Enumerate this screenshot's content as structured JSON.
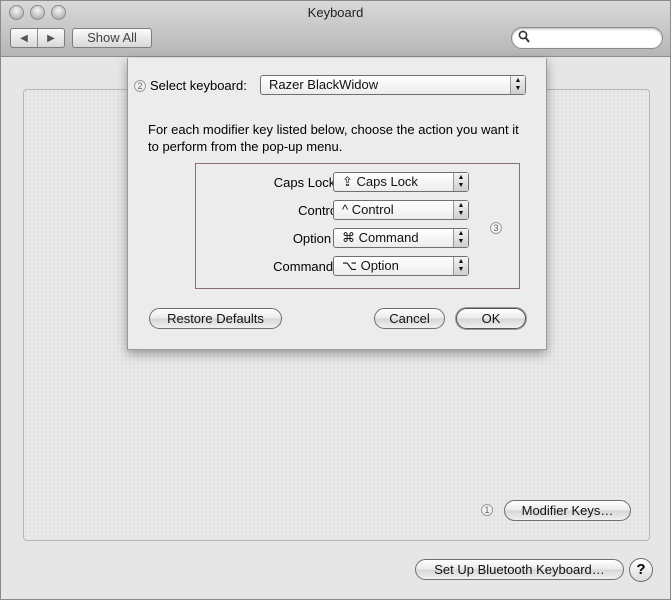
{
  "window": {
    "title": "Keyboard",
    "back_glyph": "◀",
    "forward_glyph": "▶",
    "show_all": "Show All",
    "search_placeholder": ""
  },
  "sheet": {
    "select_label": "Select keyboard:",
    "keyboard_value": "Razer BlackWidow",
    "instructions": "For each modifier key listed below, choose the action you want it to perform from the pop-up menu.",
    "modifiers": [
      {
        "label": "Caps Lock (⇪) Key:",
        "value": "⇪ Caps Lock"
      },
      {
        "label": "Control (^) Key:",
        "value": "^ Control"
      },
      {
        "label": "Option (⌥) Key:",
        "value": "⌘ Command"
      },
      {
        "label": "Command (⌘) Key:",
        "value": "⌥ Option"
      }
    ],
    "restore_defaults": "Restore Defaults",
    "cancel": "Cancel",
    "ok": "OK"
  },
  "pane": {
    "modifier_keys": "Modifier Keys…",
    "bluetooth": "Set Up Bluetooth Keyboard…",
    "help": "?"
  },
  "callouts": {
    "one": "1",
    "two": "2",
    "three": "3"
  }
}
